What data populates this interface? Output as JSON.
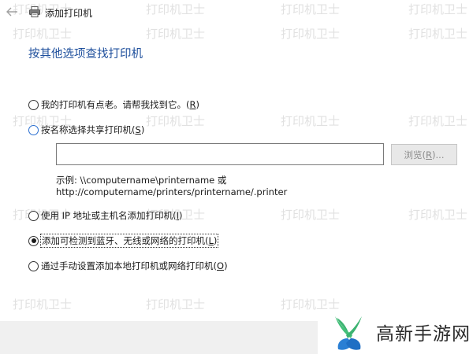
{
  "window": {
    "title": "添加打印机"
  },
  "page": {
    "heading": "按其他选项查找打印机"
  },
  "options": [
    {
      "label": "我的打印机有点老。请帮我找到它。",
      "key": "R",
      "selected": false
    },
    {
      "label": "按名称选择共享打印机",
      "key": "S",
      "selected": false
    },
    {
      "label": "使用 IP 地址或主机名添加打印机",
      "key": "I",
      "selected": false
    },
    {
      "label": "添加可检测到蓝牙、无线或网络的打印机",
      "key": "L",
      "selected": true
    },
    {
      "label": "通过手动设置添加本地打印机或网络打印机",
      "key": "O",
      "selected": false
    }
  ],
  "shared_printer": {
    "input_value": "",
    "browse_label": "浏览",
    "browse_key": "R",
    "browse_suffix": "...",
    "example_line1": "示例: \\\\computername\\printername 或",
    "example_line2": "http://computername/printers/printername/.printer"
  },
  "watermark": {
    "text": "打印机卫士"
  },
  "logo": {
    "text": "高新手游网"
  },
  "colors": {
    "heading": "#1e4f9c",
    "accent_green": "#3cb371",
    "accent_blue": "#2a7fd4"
  }
}
